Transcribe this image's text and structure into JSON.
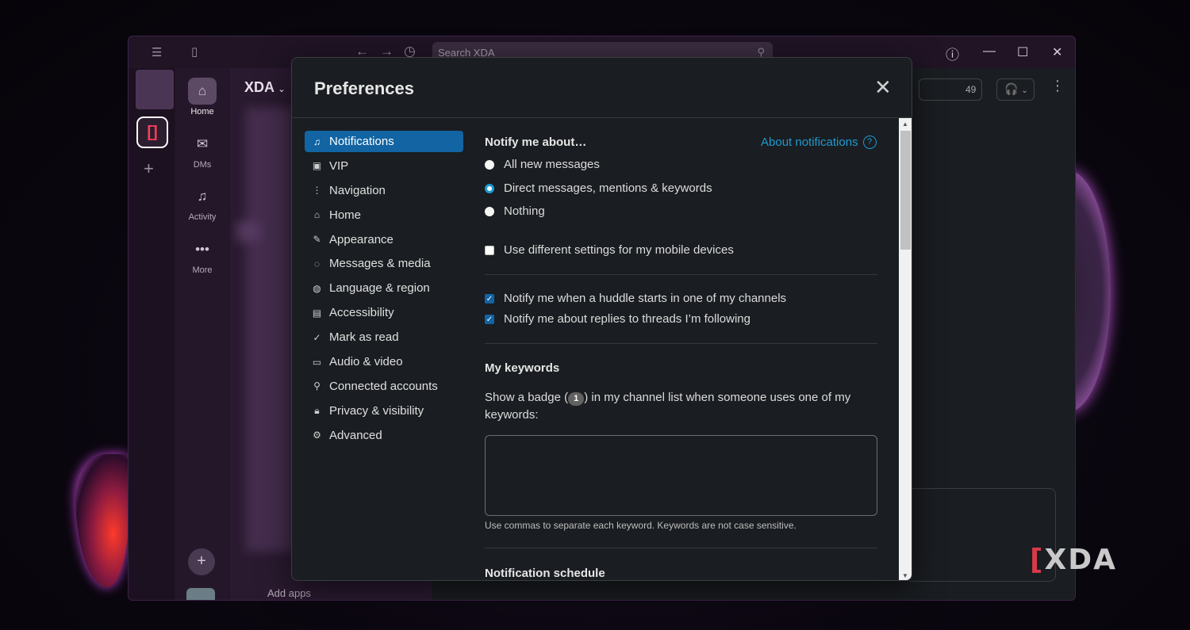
{
  "app": {
    "search_placeholder": "Search XDA",
    "workspace_name": "XDA",
    "member_count": "49",
    "add_apps": "Add apps"
  },
  "nav_rail": {
    "items": [
      {
        "label": "Home",
        "icon": "home-icon"
      },
      {
        "label": "DMs",
        "icon": "dms-icon"
      },
      {
        "label": "Activity",
        "icon": "bell-icon"
      },
      {
        "label": "More",
        "icon": "ellipsis-icon"
      }
    ]
  },
  "dialog": {
    "title": "Preferences",
    "nav": [
      {
        "label": "Notifications",
        "icon": "bell-icon",
        "active": true
      },
      {
        "label": "VIP",
        "icon": "vip-icon"
      },
      {
        "label": "Navigation",
        "icon": "navigation-icon"
      },
      {
        "label": "Home",
        "icon": "home-icon"
      },
      {
        "label": "Appearance",
        "icon": "brush-icon"
      },
      {
        "label": "Messages & media",
        "icon": "message-icon"
      },
      {
        "label": "Language & region",
        "icon": "globe-icon"
      },
      {
        "label": "Accessibility",
        "icon": "accessibility-icon"
      },
      {
        "label": "Mark as read",
        "icon": "check-circle-icon"
      },
      {
        "label": "Audio & video",
        "icon": "video-icon"
      },
      {
        "label": "Connected accounts",
        "icon": "plug-icon"
      },
      {
        "label": "Privacy & visibility",
        "icon": "lock-icon"
      },
      {
        "label": "Advanced",
        "icon": "gear-icon"
      }
    ],
    "notify_heading": "Notify me about…",
    "about_link": "About notifications",
    "radio_options": [
      {
        "label": "All new messages",
        "selected": false
      },
      {
        "label": "Direct messages, mentions & keywords",
        "selected": true
      },
      {
        "label": "Nothing",
        "selected": false
      }
    ],
    "mobile_checkbox": {
      "label": "Use different settings for my mobile devices",
      "checked": false
    },
    "huddle_checkbox": {
      "label": "Notify me when a huddle starts in one of my channels",
      "checked": true
    },
    "threads_checkbox": {
      "label": "Notify me about replies to threads I’m following",
      "checked": true
    },
    "keywords_heading": "My keywords",
    "keywords_text_before": "Show a badge (",
    "keywords_badge": "1",
    "keywords_text_after": ") in my channel list when someone uses one of my keywords:",
    "keywords_value": "",
    "keywords_hint": "Use commas to separate each keyword. Keywords are not case sensitive.",
    "schedule_heading": "Notification schedule"
  },
  "watermark": {
    "text": "XDA"
  },
  "colors": {
    "accent": "#1264a3",
    "link": "#1d9bd1",
    "background": "#1a1d21"
  }
}
